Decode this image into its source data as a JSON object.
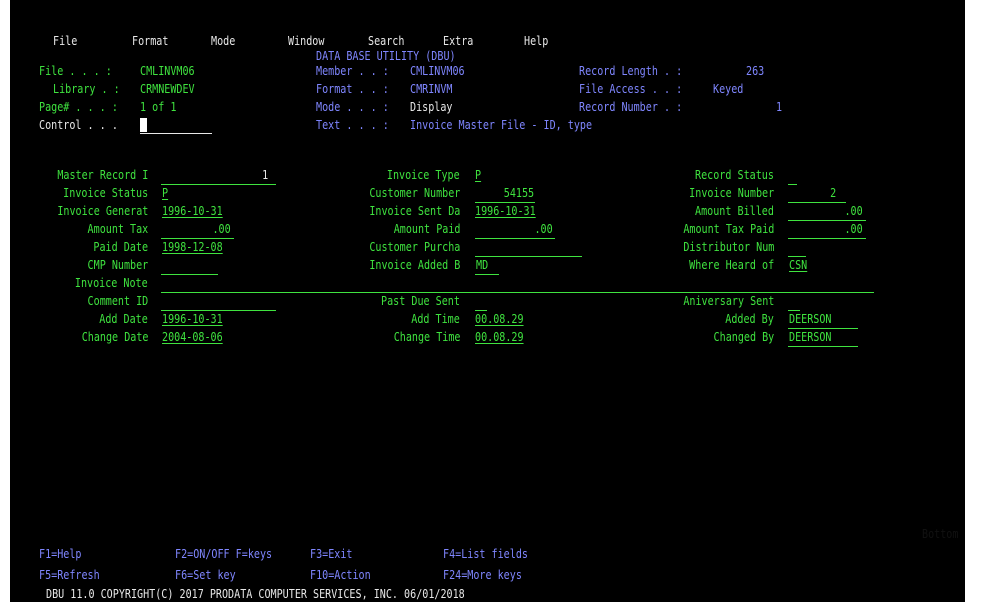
{
  "menu": [
    "File",
    "Format",
    "Mode",
    "Window",
    "Search",
    "Extra",
    "Help"
  ],
  "header": {
    "title": "DATA BASE UTILITY (DBU)",
    "file_label": "File . . . :",
    "file_value": "CMLINVM06",
    "library_label": "Library . :",
    "library_value": "CRMNEWDEV",
    "page_label": "Page# . . . :",
    "page_value": "1 of 1",
    "control_label": "Control . . .",
    "member_label": "Member . . :",
    "member_value": "CMLINVM06",
    "format_label": "Format . . :",
    "format_value": "CMRINVM",
    "mode_label": "Mode . . . :",
    "mode_value": "Display",
    "text_label": "Text . . . :",
    "text_value": "Invoice Master File - ID, type",
    "reclen_label": "Record Length . :",
    "reclen_value": "263",
    "access_label": "File Access . . :",
    "access_value": "Keyed",
    "recnum_label": "Record Number . :",
    "recnum_value": "1"
  },
  "fields": {
    "master_record_label": "Master Record I",
    "master_record_value": "1",
    "invoice_status_label": "Invoice Status",
    "invoice_status_value": "P",
    "invoice_generat_label": "Invoice Generat",
    "invoice_generat_value": "1996-10-31",
    "amount_tax_label": "Amount Tax",
    "amount_tax_value": ".00",
    "paid_date_label": "Paid Date",
    "paid_date_value": "1998-12-08",
    "cmp_number_label": "CMP Number",
    "cmp_number_value": "",
    "invoice_note_label": "Invoice Note",
    "invoice_note_value": "",
    "comment_id_label": "Comment ID",
    "comment_id_value": "",
    "add_date_label": "Add Date",
    "add_date_value": "1996-10-31",
    "change_date_label": "Change Date",
    "change_date_value": "2004-08-06",
    "invoice_type_label": "Invoice Type",
    "invoice_type_value": "P",
    "customer_number_label": "Customer Number",
    "customer_number_value": "54155",
    "invoice_sent_label": "Invoice Sent Da",
    "invoice_sent_value": "1996-10-31",
    "amount_paid_label": "Amount Paid",
    "amount_paid_value": ".00",
    "customer_purcha_label": "Customer Purcha",
    "customer_purcha_value": "",
    "invoice_added_label": "Invoice Added B",
    "invoice_added_value": "MD",
    "past_due_label": "Past Due Sent",
    "past_due_value": "",
    "add_time_label": "Add Time",
    "add_time_value": "00.08.29",
    "change_time_label": "Change Time",
    "change_time_value": "00.08.29",
    "record_status_label": "Record Status",
    "record_status_value": "",
    "invoice_number_label": "Invoice Number",
    "invoice_number_value": "2",
    "amount_billed_label": "Amount Billed",
    "amount_billed_value": ".00",
    "amount_tax_paid_label": "Amount Tax Paid",
    "amount_tax_paid_value": ".00",
    "distributor_label": "Distributor Num",
    "distributor_value": "",
    "where_heard_label": "Where Heard of",
    "where_heard_value": "CSN",
    "aniversary_label": "Aniversary Sent",
    "aniversary_value": "",
    "added_by_label": "Added By",
    "added_by_value": "DEERSON",
    "changed_by_label": "Changed By",
    "changed_by_value": "DEERSON"
  },
  "fkeys": {
    "f1": "F1=Help",
    "f2": "F2=ON/OFF F=keys",
    "f3": "F3=Exit",
    "f4": "F4=List fields",
    "f5": "F5=Refresh",
    "f6": "F6=Set key",
    "f10": "F10=Action",
    "f24": "F24=More keys"
  },
  "bottom": "Bottom",
  "copyright": "DBU 11.0 COPYRIGHT(C) 2017 PRODATA COMPUTER SERVICES, INC. 06/01/2018",
  "colors": {
    "background": "#000000",
    "green": "#3fe33f",
    "blue": "#7f86ff",
    "white": "#e8e8e8"
  }
}
